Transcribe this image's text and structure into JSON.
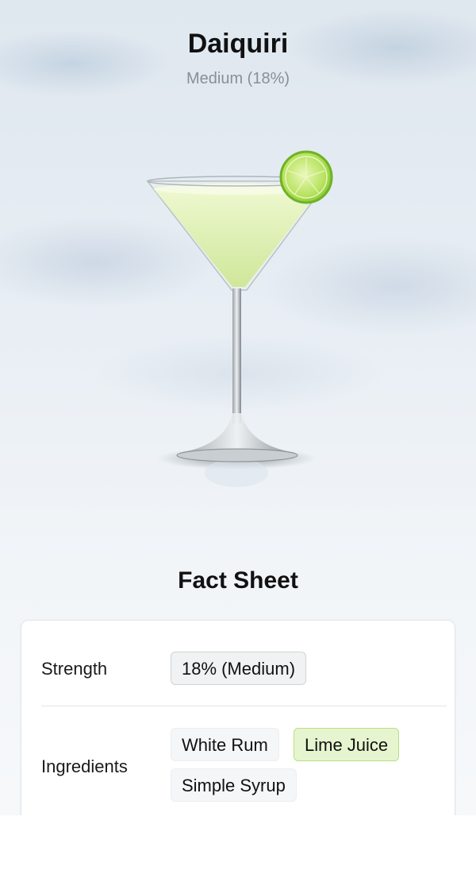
{
  "drink": {
    "name": "Daiquiri",
    "strength_summary": "Medium (18%)"
  },
  "fact_sheet": {
    "title": "Fact Sheet",
    "strength": {
      "label": "Strength",
      "value": "18% (Medium)"
    },
    "ingredients": {
      "label": "Ingredients",
      "items": [
        "White Rum",
        "Lime Juice",
        "Simple Syrup"
      ],
      "highlighted": "Lime Juice"
    }
  },
  "colors": {
    "highlight_bg": "#e6f5cf",
    "highlight_border": "#b9df82",
    "drink_liquid": "#dcefb0",
    "lime": "#8ccf3a"
  },
  "icons": {
    "hero_image": "daiquiri-cocktail-glass-with-lime"
  }
}
